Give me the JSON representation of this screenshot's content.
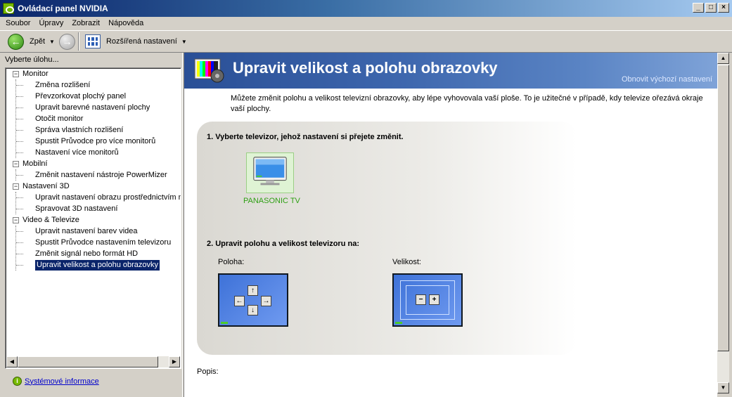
{
  "window": {
    "title": "Ovládací panel NVIDIA"
  },
  "menu": [
    "Soubor",
    "Úpravy",
    "Zobrazit",
    "Nápověda"
  ],
  "toolbar": {
    "back_label": "Zpět",
    "advanced_label": "Rozšířená nastavení"
  },
  "sidebar": {
    "header": "Vyberte úlohu...",
    "groups": [
      {
        "label": "Monitor",
        "items": [
          "Změna rozlišení",
          "Převzorkovat plochý panel",
          "Upravit barevné nastavení plochy",
          "Otočit monitor",
          "Správa vlastních rozlišení",
          "Spustit Průvodce pro více monitorů",
          "Nastavení více monitorů"
        ]
      },
      {
        "label": "Mobilní",
        "items": [
          "Změnit nastavení nástroje PowerMizer"
        ]
      },
      {
        "label": "Nastavení 3D",
        "items": [
          "Upravit nastavení obrazu prostřednictvím n",
          "Spravovat 3D nastavení"
        ]
      },
      {
        "label": "Video & Televize",
        "items": [
          "Upravit nastavení barev videa",
          "Spustit Průvodce nastavením televizoru",
          "Změnit signál nebo formát HD",
          "Upravit velikost a polohu obrazovky"
        ]
      }
    ],
    "sysinfo_link": "Systémové informace"
  },
  "content": {
    "title": "Upravit velikost a polohu obrazovky",
    "restore_link": "Obnovit výchozí nastavení",
    "intro": "Můžete změnit polohu a velikost televizní obrazovky, aby lépe vyhovovala vaší ploše.  To je užitečné v případě, kdy televize ořezává okraje vaší plochy.",
    "step1": "1. Vyberte televizor, jehož nastavení si přejete změnit.",
    "tv_name": "PANASONIC TV",
    "step2": "2. Upravit polohu a velikost televizoru na:",
    "position_label": "Poloha:",
    "size_label": "Velikost:",
    "description_label": "Popis:"
  },
  "colors": {
    "banner": "#2a4f96",
    "selection": "#0a246a",
    "tv_name": "#2fa014",
    "link": "#0000cc"
  }
}
